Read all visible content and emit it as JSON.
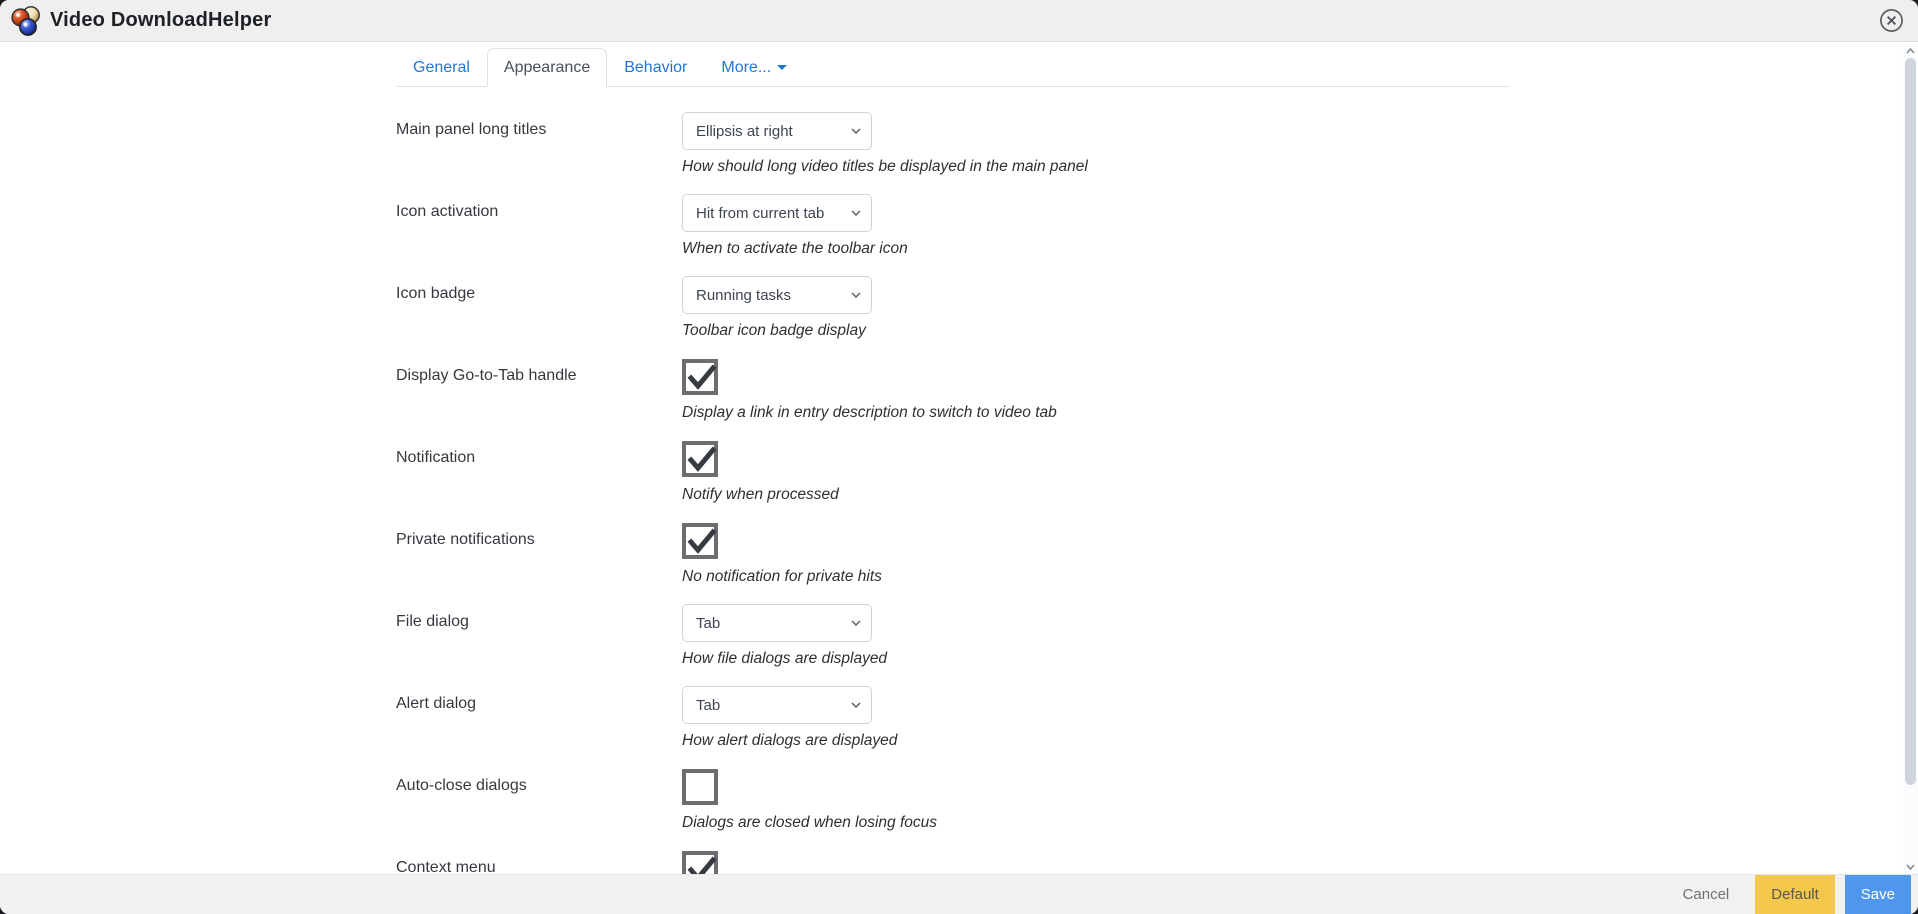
{
  "window_title": "Video DownloadHelper",
  "tabs": [
    {
      "label": "General",
      "active": false
    },
    {
      "label": "Appearance",
      "active": true
    },
    {
      "label": "Behavior",
      "active": false
    },
    {
      "label": "More...",
      "active": false,
      "has_caret": true
    }
  ],
  "form": {
    "rows": [
      {
        "label": "Main panel long titles",
        "type": "select",
        "value": "Ellipsis at right",
        "description": "How should long video titles be displayed in the main panel"
      },
      {
        "label": "Icon activation",
        "type": "select",
        "value": "Hit from current tab",
        "description": "When to activate the toolbar icon"
      },
      {
        "label": "Icon badge",
        "type": "select",
        "value": "Running tasks",
        "description": "Toolbar icon badge display"
      },
      {
        "label": "Display Go-to-Tab handle",
        "type": "checkbox",
        "checked": true,
        "description": "Display a link in entry description to switch to video tab"
      },
      {
        "label": "Notification",
        "type": "checkbox",
        "checked": true,
        "description": "Notify when processed"
      },
      {
        "label": "Private notifications",
        "type": "checkbox",
        "checked": true,
        "description": "No notification for private hits"
      },
      {
        "label": "File dialog",
        "type": "select",
        "value": "Tab",
        "description": "How file dialogs are displayed"
      },
      {
        "label": "Alert dialog",
        "type": "select",
        "value": "Tab",
        "description": "How alert dialogs are displayed"
      },
      {
        "label": "Auto-close dialogs",
        "type": "checkbox",
        "checked": false,
        "description": "Dialogs are closed when losing focus"
      },
      {
        "label": "Context menu",
        "type": "checkbox",
        "checked": true,
        "description": ""
      }
    ]
  },
  "footer": {
    "cancel_label": "Cancel",
    "default_label": "Default",
    "save_label": "Save"
  },
  "icons": {
    "app_logo": "video-downloadhelper-balls-logo",
    "close": "circle-x-icon",
    "select_chevron": "chevron-down-icon",
    "more_caret": "caret-down-icon",
    "scroll_up": "chevron-up-icon",
    "scroll_down": "chevron-down-icon"
  },
  "colors": {
    "header_bg": "#efefef",
    "footer_bg": "#f1f1f1",
    "accent_blue": "#2176d9",
    "save_blue": "#4f97ec",
    "default_yellow": "#f3c84c",
    "border_gray": "#dee2e6",
    "checkbox_border": "#6d6d6d",
    "check_color": "#363b42",
    "scrollbar_thumb": "#cdd4dd"
  }
}
